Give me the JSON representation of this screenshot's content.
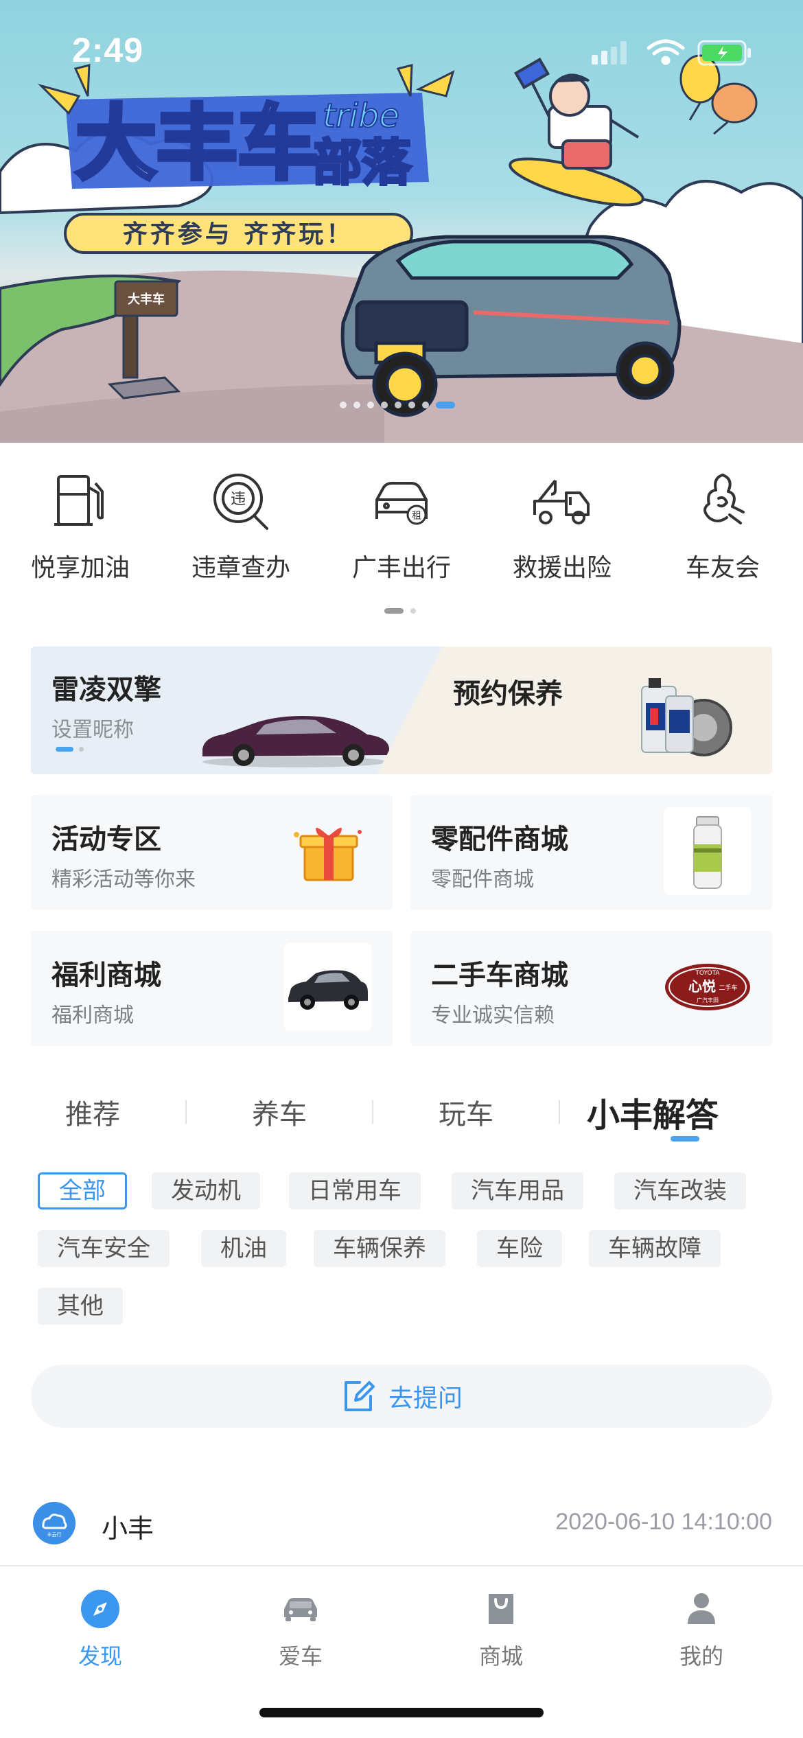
{
  "status_bar": {
    "time": "2:49"
  },
  "banner": {
    "title": "大丰车",
    "title_suffix_en": "tribe",
    "title_suffix_cn": "部落",
    "slogan": "齐齐参与 齐齐玩！",
    "signpost": "大丰车",
    "pager": {
      "count": 8,
      "active_index": 7
    }
  },
  "quick_menu": {
    "items": [
      {
        "label": "悦享加油",
        "icon": "fuel-pump-icon"
      },
      {
        "label": "违章查办",
        "icon": "violation-search-icon"
      },
      {
        "label": "广丰出行",
        "icon": "rental-car-icon"
      },
      {
        "label": "救援出险",
        "icon": "tow-truck-icon"
      },
      {
        "label": "车友会",
        "icon": "club-icon"
      }
    ],
    "pager": {
      "count": 2,
      "active_index": 0
    }
  },
  "car_card": {
    "car_name": "雷凌双擎",
    "nickname_hint": "设置昵称",
    "maintenance_title": "预约保养"
  },
  "tiles": [
    {
      "title": "活动专区",
      "subtitle": "精彩活动等你来",
      "image": "gift-box"
    },
    {
      "title": "零配件商城",
      "subtitle": "零配件商城",
      "image": "spray-can"
    },
    {
      "title": "福利商城",
      "subtitle": "福利商城",
      "image": "suv-car"
    },
    {
      "title": "二手车商城",
      "subtitle": "专业诚实信赖",
      "image": "used-car-logo",
      "logo_top": "TOYOTA",
      "logo_mid": "心悦",
      "logo_small": "二手车",
      "logo_bottom": "广汽丰田"
    }
  ],
  "tabs": {
    "items": [
      "推荐",
      "养车",
      "玩车",
      "小丰解答"
    ],
    "active_index": 3
  },
  "categories": {
    "items": [
      "全部",
      "发动机",
      "日常用车",
      "汽车用品",
      "汽车改装",
      "汽车安全",
      "机油",
      "车辆保养",
      "车险",
      "车辆故障",
      "其他"
    ],
    "active_index": 0
  },
  "ask_button": {
    "label": "去提问"
  },
  "post": {
    "author": "小丰",
    "timestamp": "2020-06-10 14:10:00",
    "avatar_text": "丰云行"
  },
  "bottom_nav": {
    "items": [
      {
        "label": "发现",
        "icon": "compass-icon"
      },
      {
        "label": "爱车",
        "icon": "car-icon"
      },
      {
        "label": "商城",
        "icon": "shopping-bag-icon"
      },
      {
        "label": "我的",
        "icon": "profile-icon"
      }
    ],
    "active_index": 0
  },
  "colors": {
    "accent": "#3a96ee",
    "banner_sky": "#8fd3df",
    "tab_underline": "#4aa3f0"
  }
}
